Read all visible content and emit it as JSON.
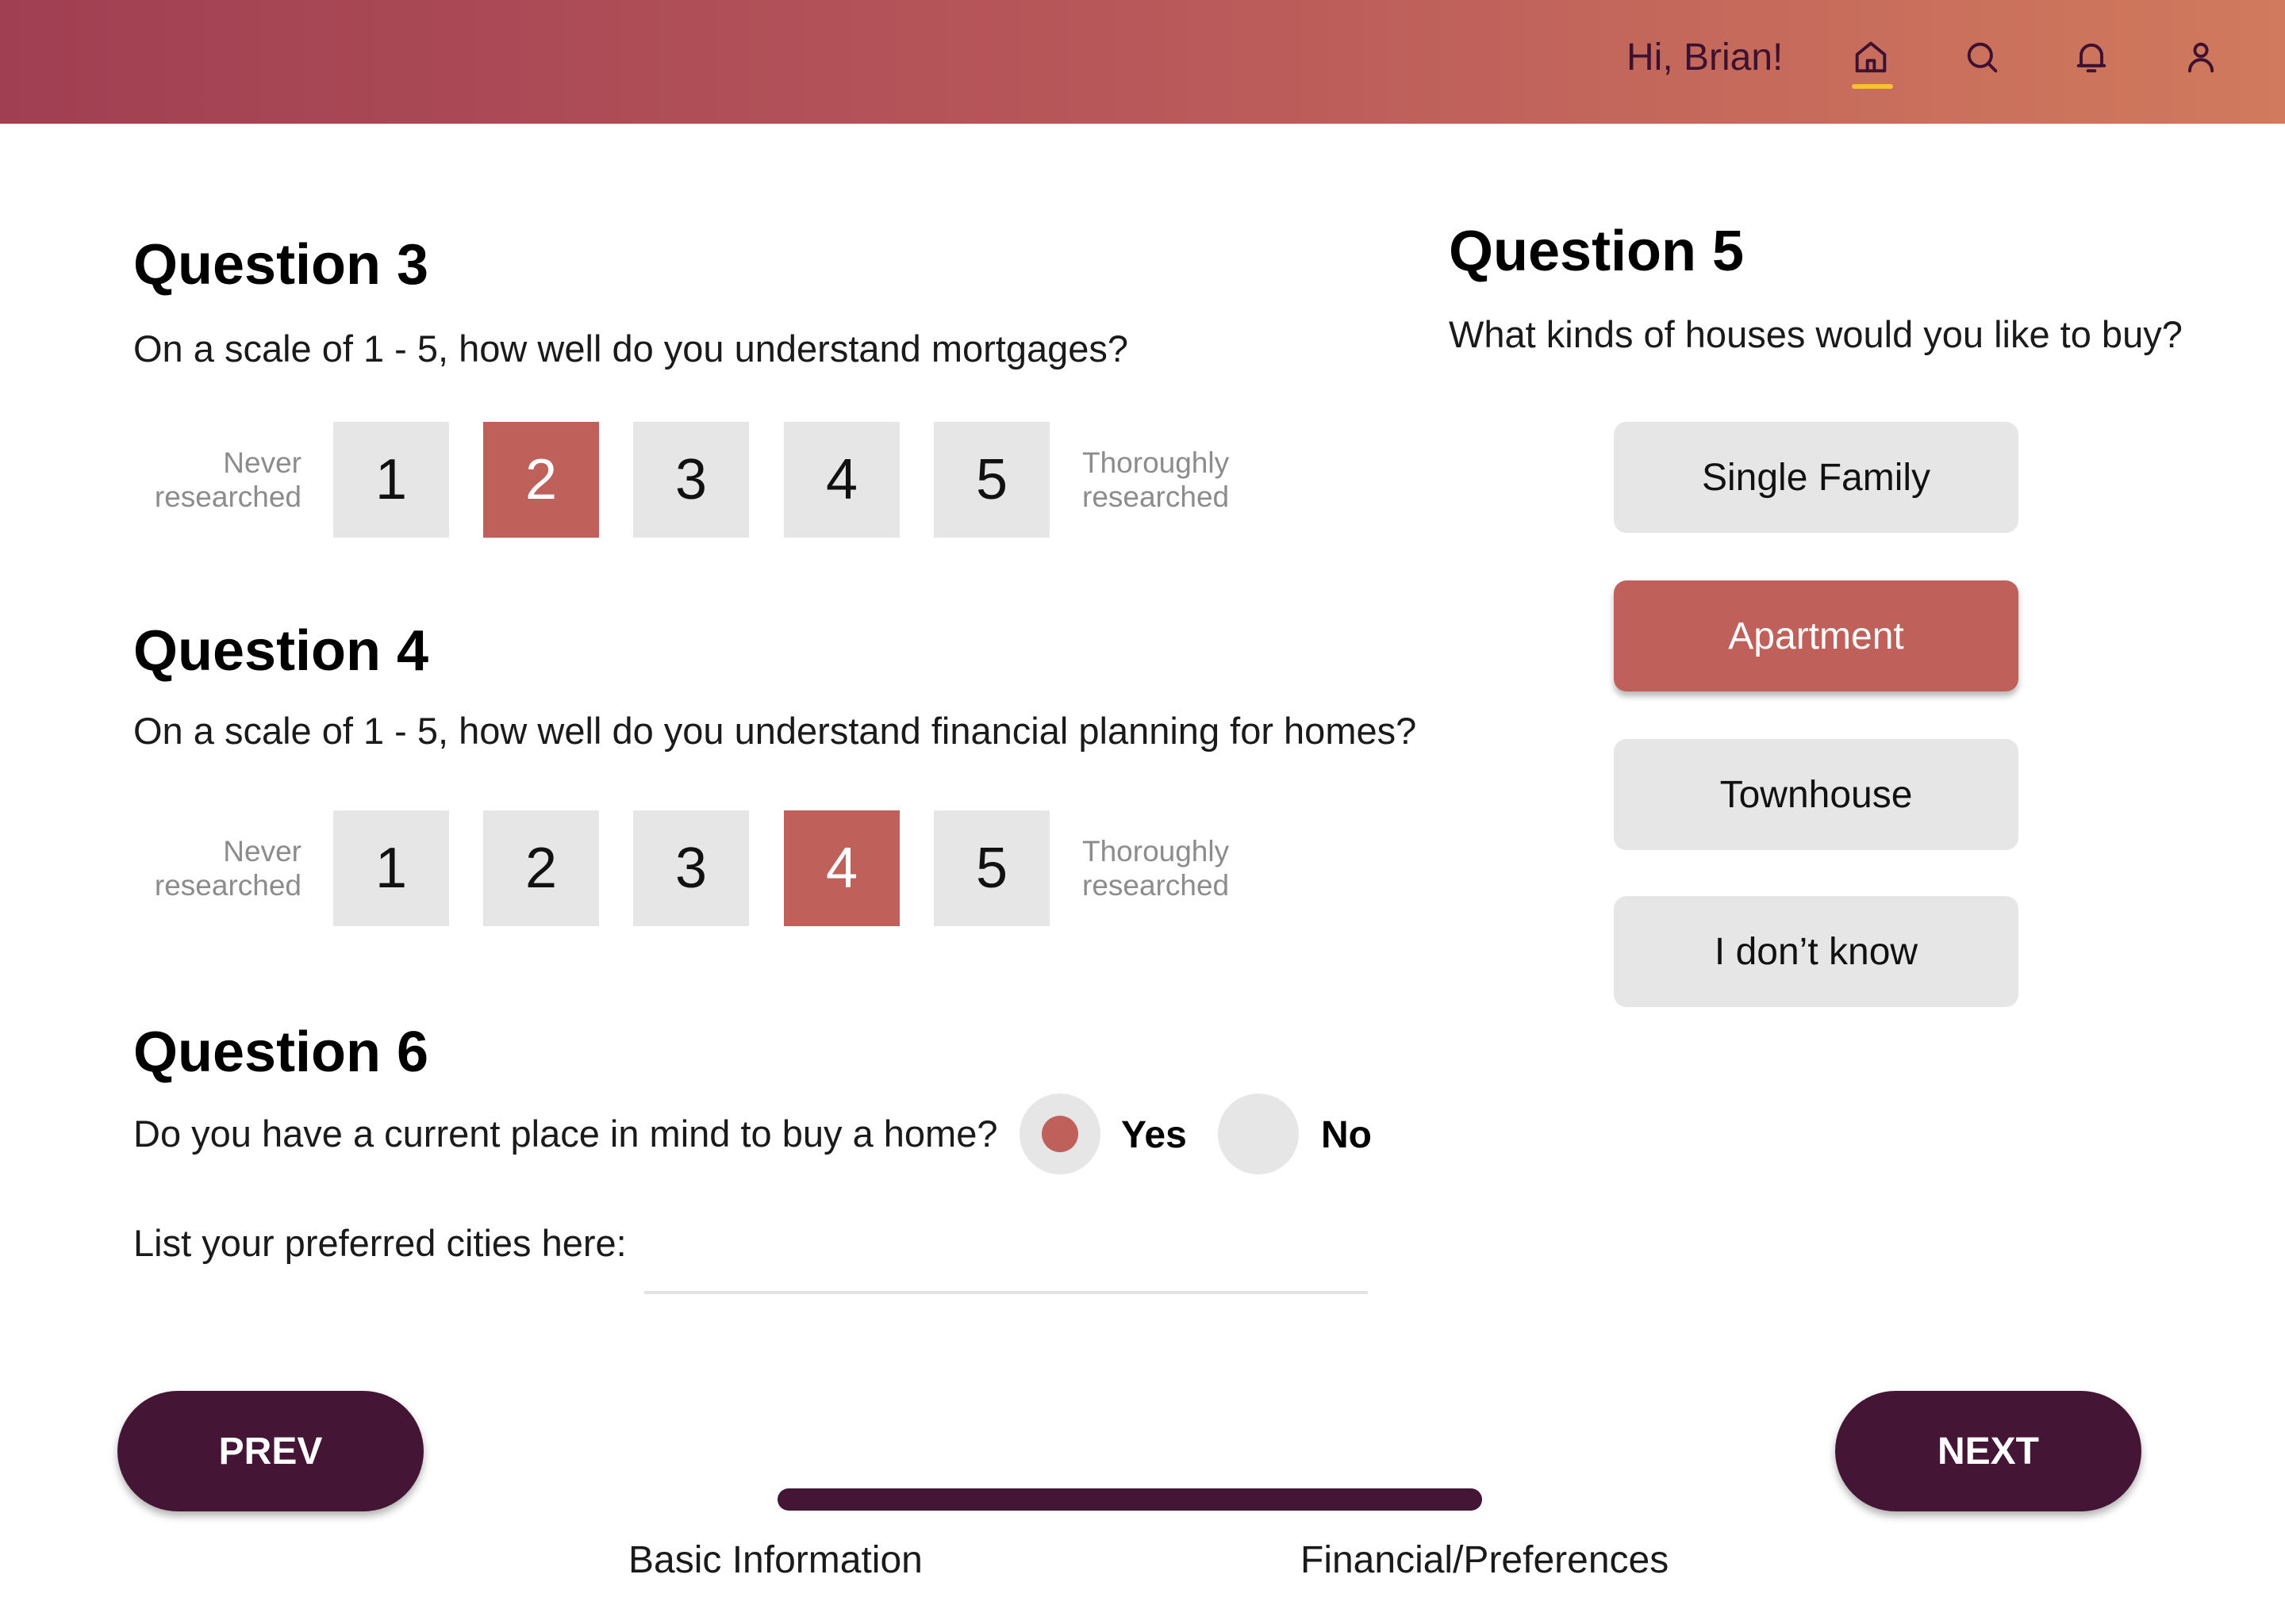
{
  "header": {
    "greeting": "Hi, Brian!",
    "icons": [
      "home-icon",
      "search-icon",
      "bell-icon",
      "user-icon"
    ],
    "active_icon": "home-icon",
    "colors": {
      "gradient_start": "#a03f52",
      "gradient_end": "#d17a5d",
      "active_underline": "#f2c232"
    }
  },
  "colors": {
    "selected": "#c0605b",
    "unselected": "#e6e6e6",
    "primary_button": "#451535"
  },
  "question3": {
    "title": "Question 3",
    "text": "On a scale of 1 - 5, how well do you understand mortgages?",
    "min_label": "Never researched",
    "max_label": "Thoroughly researched",
    "options": [
      "1",
      "2",
      "3",
      "4",
      "5"
    ],
    "selected": "2"
  },
  "question4": {
    "title": "Question 4",
    "text": "On a scale of 1 - 5, how well do you understand financial planning for homes?",
    "min_label": "Never researched",
    "max_label": "Thoroughly researched",
    "options": [
      "1",
      "2",
      "3",
      "4",
      "5"
    ],
    "selected": "4"
  },
  "question5": {
    "title": "Question 5",
    "text": "What kinds of houses would you like to buy?",
    "options": [
      "Single Family",
      "Apartment",
      "Townhouse",
      "I don’t know"
    ],
    "selected": "Apartment"
  },
  "question6": {
    "title": "Question 6",
    "text": "Do you have a current place in mind to buy a home?",
    "yes_label": "Yes",
    "no_label": "No",
    "selected": "Yes",
    "cities_label": "List your preferred cities here:",
    "cities_value": ""
  },
  "footer": {
    "prev_label": "PREV",
    "next_label": "NEXT",
    "steps": [
      "Basic Information",
      "Financial/Preferences"
    ],
    "progress": 1.0
  }
}
